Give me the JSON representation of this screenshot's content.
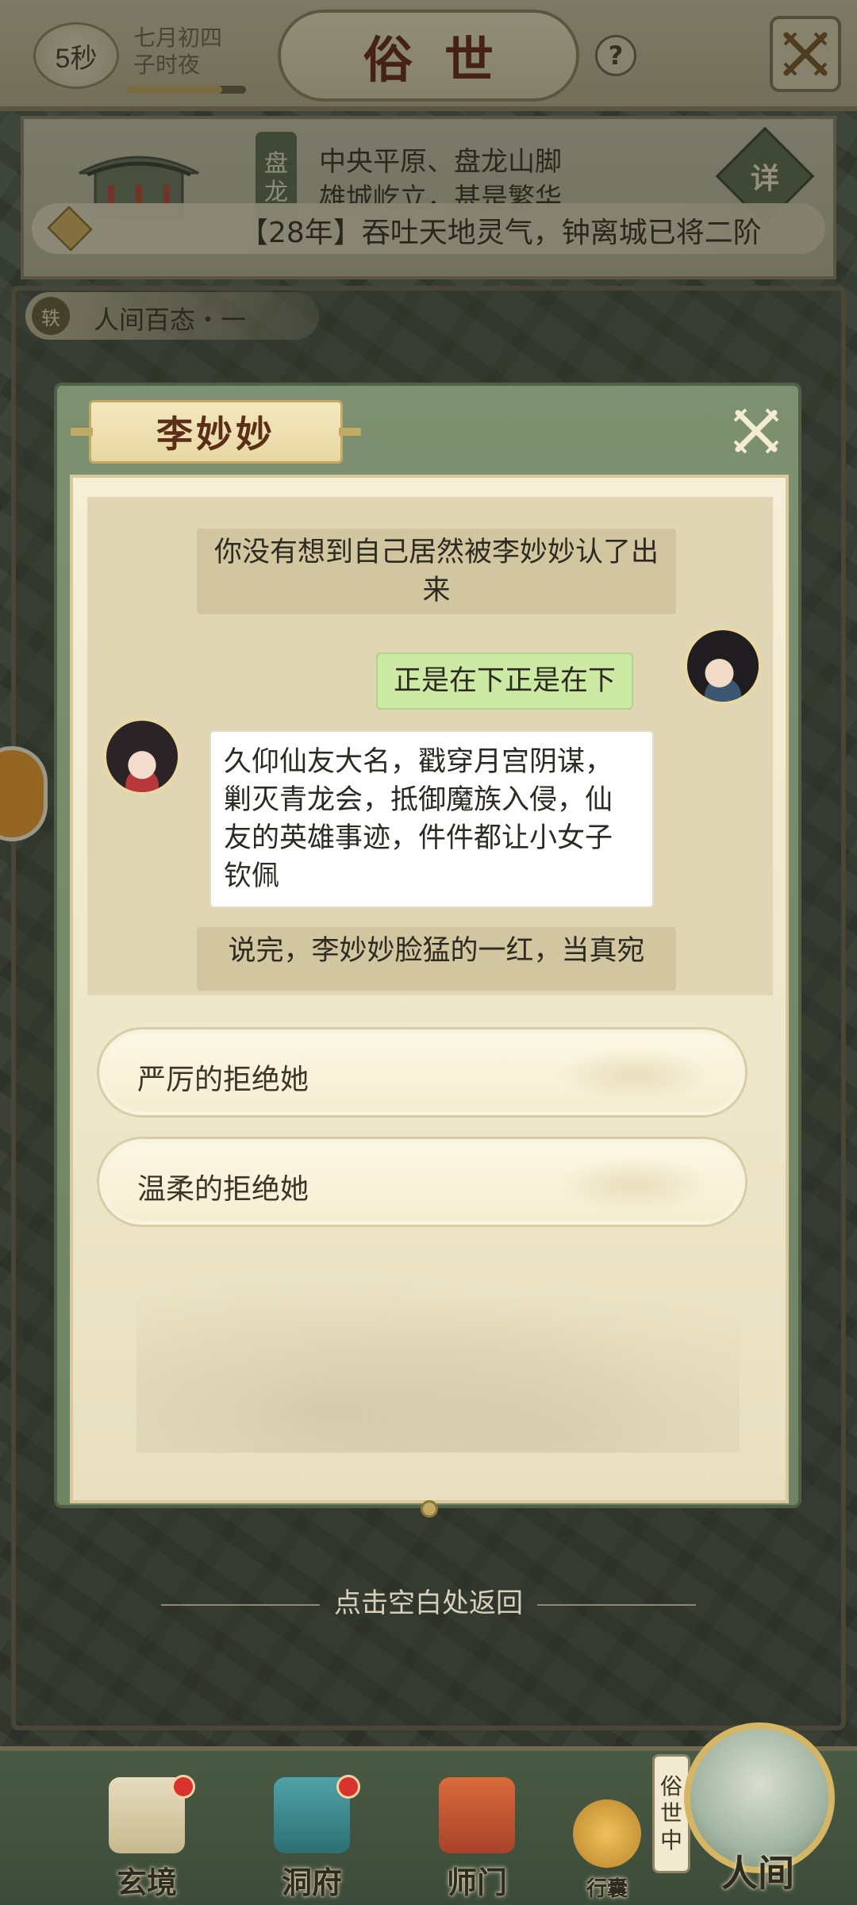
{
  "header": {
    "timer": "5秒",
    "date": "七月初四",
    "time_of_day": "子时夜",
    "time_progress": 0.8,
    "title": "俗世",
    "help_label": "?"
  },
  "location": {
    "place_tag": [
      "盘",
      "龙"
    ],
    "line1": "中央平原、盘龙山脚",
    "line2": "雄城屹立，甚是繁华",
    "detail_label": "详",
    "news": "【28年】吞吐天地灵气，钟离城已将二阶"
  },
  "section": {
    "badge": "轶",
    "title": "人间百态・一"
  },
  "dialog": {
    "npc_name": "李妙妙",
    "messages": [
      {
        "type": "narration",
        "text": "你没有想到自己居然被李妙妙认了出来"
      },
      {
        "type": "player",
        "text": "正是在下正是在下"
      },
      {
        "type": "npc",
        "text": "久仰仙友大名，戳穿月宫阴谋，剿灭青龙会，抵御魔族入侵，仙友的英雄事迹，件件都让小女子钦佩"
      },
      {
        "type": "narration",
        "text": "说完，李妙妙脸猛的一红，当真宛"
      }
    ],
    "choices": [
      "严厉的拒绝她",
      "温柔的拒绝她"
    ]
  },
  "return_hint": "点击空白处返回",
  "bottom_nav": {
    "items": [
      "玄境",
      "洞府",
      "师门",
      "行囊"
    ],
    "status": [
      "俗",
      "世",
      "中"
    ],
    "current": "人间"
  },
  "colors": {
    "accent_green": "#6e8462",
    "parchment": "#f5efd8",
    "title_red": "#6b2a1c",
    "player_bubble": "#cdeaa5"
  }
}
